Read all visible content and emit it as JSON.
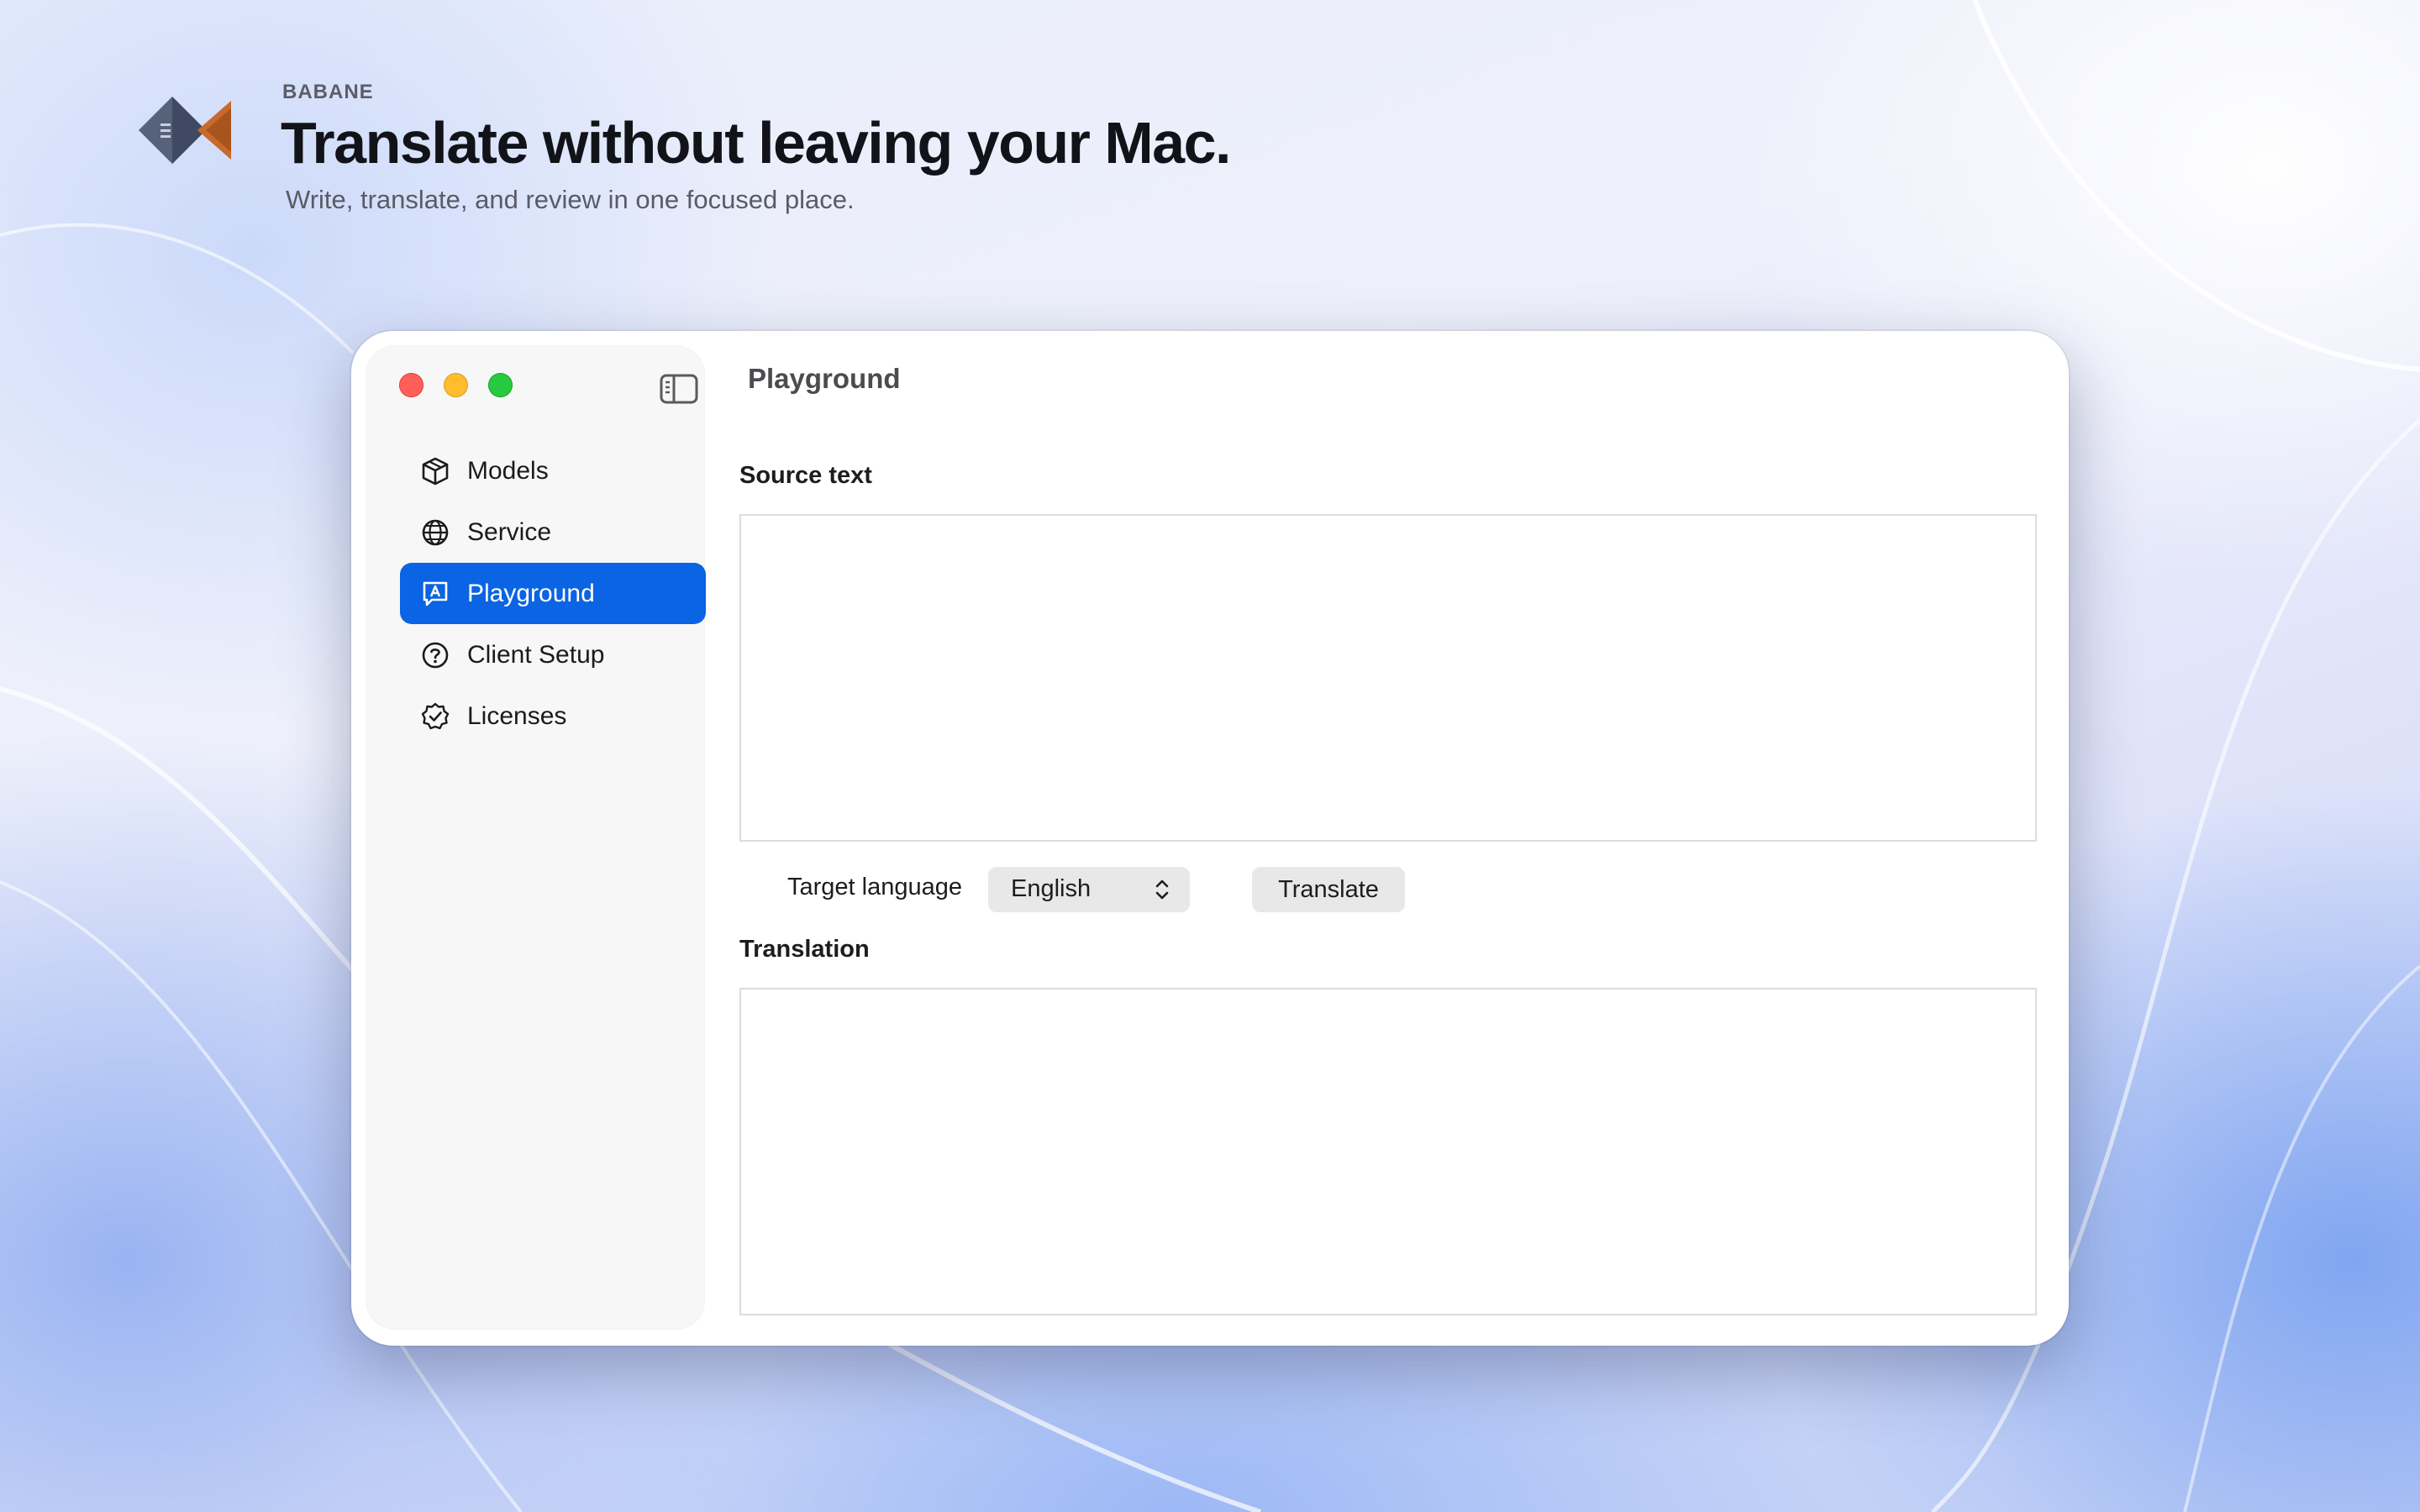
{
  "header": {
    "brand": "BABANE",
    "headline": "Translate without leaving your Mac.",
    "subhead": "Write, translate, and review in one focused place."
  },
  "window": {
    "title": "Playground",
    "sidebar": {
      "items": [
        {
          "label": "Models",
          "icon": "cube-icon"
        },
        {
          "label": "Service",
          "icon": "globe-icon"
        },
        {
          "label": "Playground",
          "icon": "translate-bubble-icon",
          "selected": true
        },
        {
          "label": "Client Setup",
          "icon": "question-circle-icon"
        },
        {
          "label": "Licenses",
          "icon": "checkmark-seal-icon"
        }
      ]
    },
    "source": {
      "label": "Source text",
      "value": ""
    },
    "target": {
      "label": "Target language",
      "selected": "English"
    },
    "translate_button": "Translate",
    "translation": {
      "label": "Translation",
      "value": ""
    }
  },
  "colors": {
    "accent": "#0a64e3",
    "traffic_red": "#ff5f57",
    "traffic_yellow": "#febc2e",
    "traffic_green": "#28c840"
  }
}
